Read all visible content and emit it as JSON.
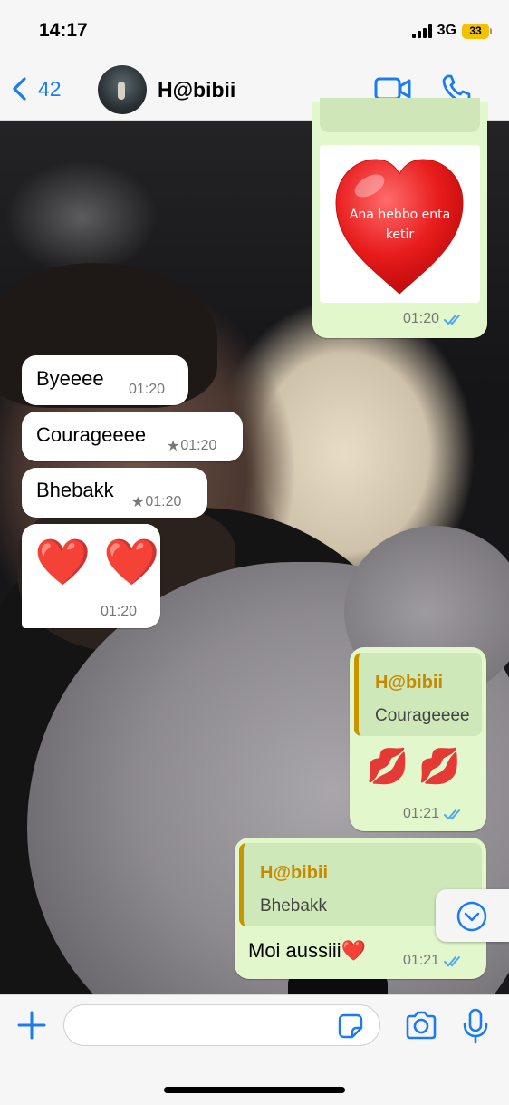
{
  "status_bar": {
    "time": "14:17",
    "network": "3G",
    "battery": "33"
  },
  "header": {
    "back_count": "42",
    "contact_name": "H@bibii"
  },
  "messages": {
    "sticker": {
      "caption_line1": "Ana hebbo enta",
      "caption_line2": "ketir",
      "time": "01:20",
      "status": "read"
    },
    "in": [
      {
        "text": "Byeeee",
        "time": "01:20",
        "starred": false
      },
      {
        "text": "Courageeee",
        "time": "01:20",
        "starred": true,
        "star": "★"
      },
      {
        "text": "Bhebakk",
        "time": "01:20",
        "starred": true,
        "star": "★"
      },
      {
        "text": "❤️ ❤️",
        "time": "01:20",
        "starred": false
      }
    ],
    "reply1": {
      "quote_name": "H@bibii",
      "quote_text": "Courageeee",
      "body": "💋 💋",
      "time": "01:21",
      "status": "read"
    },
    "reply2": {
      "quote_name": "H@bibii",
      "quote_text": "Bhebakk",
      "body": "Moi aussiii❤️",
      "time": "01:21",
      "status": "read"
    }
  },
  "input": {
    "placeholder": "",
    "value": ""
  },
  "colors": {
    "accent": "#1a7cf0",
    "outgoing_bubble": "#e2f7cb",
    "incoming_bubble": "#ffffff",
    "quote_name": "#c68a00",
    "read_ticks": "#4fa8f0"
  },
  "icons": {
    "back": "chevron-left-icon",
    "video": "video-camera-icon",
    "call": "phone-icon",
    "scroll": "chevron-down-circle-icon",
    "attach": "plus-icon",
    "sticker": "sticker-icon",
    "camera": "camera-icon",
    "mic": "microphone-icon"
  }
}
